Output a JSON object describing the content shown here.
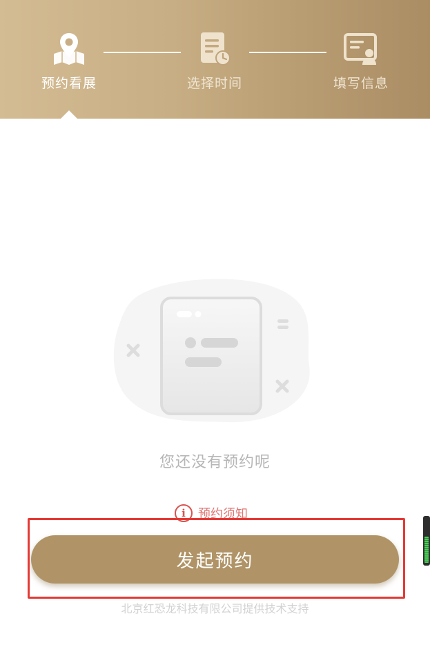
{
  "steps": [
    {
      "label": "预约看展",
      "icon": "map-pin-icon",
      "active": true
    },
    {
      "label": "选择时间",
      "icon": "document-clock-icon",
      "active": false
    },
    {
      "label": "填写信息",
      "icon": "id-card-icon",
      "active": false
    }
  ],
  "empty_state": {
    "icon": "empty-document-icon",
    "text": "您还没有预约呢"
  },
  "notice": {
    "icon": "info-icon",
    "label": "预约须知"
  },
  "cta": {
    "label": "发起预约"
  },
  "footer": {
    "credit": "北京红恐龙科技有限公司提供技术支持"
  },
  "colors": {
    "header_gradient_start": "#d3bb93",
    "header_gradient_end": "#ab8d64",
    "cta_background": "#b09467",
    "notice_red": "#d9534f",
    "highlight_red": "#e53935",
    "muted_text": "#b6b6b6"
  }
}
